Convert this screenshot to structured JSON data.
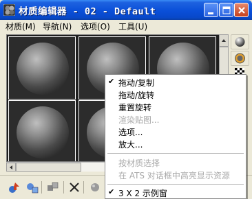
{
  "window": {
    "title": "材质编辑器 - 02 - Default"
  },
  "menubar": {
    "items": [
      {
        "label": "材质(M)"
      },
      {
        "label": "导航(N)"
      },
      {
        "label": "选项(O)"
      },
      {
        "label": "工具(U)"
      }
    ]
  },
  "sample_slots": {
    "count_visible": 6,
    "material": "gray-sphere"
  },
  "context_menu": {
    "items": [
      {
        "label": "拖动/复制",
        "checked": true,
        "disabled": false
      },
      {
        "label": "拖动/旋转",
        "checked": false,
        "disabled": false
      },
      {
        "label": "重置旋转",
        "checked": false,
        "disabled": false
      },
      {
        "label": "渲染贴图...",
        "checked": false,
        "disabled": true
      },
      {
        "label": "选项...",
        "checked": false,
        "disabled": false
      },
      {
        "label": "放大...",
        "checked": false,
        "disabled": false
      },
      {
        "label": "按材质选择",
        "checked": false,
        "disabled": true
      },
      {
        "label": "在 ATS 对话框中高亮显示资源",
        "checked": false,
        "disabled": true
      },
      {
        "label": "3 X 2 示例窗",
        "checked": true,
        "disabled": false
      }
    ]
  },
  "colors": {
    "titlebar": "#0a4fd8",
    "menu_bg": "#ece9d8",
    "sample_bg": "#1e1e1e",
    "disabled_text": "#a8a8a8"
  },
  "icons": {
    "app": "material-editor-icon",
    "vtoolbar": [
      "sphere-type-icon",
      "backlight-icon",
      "background-checker-icon"
    ],
    "btoolbar": [
      "get-material-icon",
      "put-to-scene-icon",
      "assign-to-selection-icon",
      "reset-map-icon",
      "delete-icon",
      "make-unique-icon"
    ]
  }
}
